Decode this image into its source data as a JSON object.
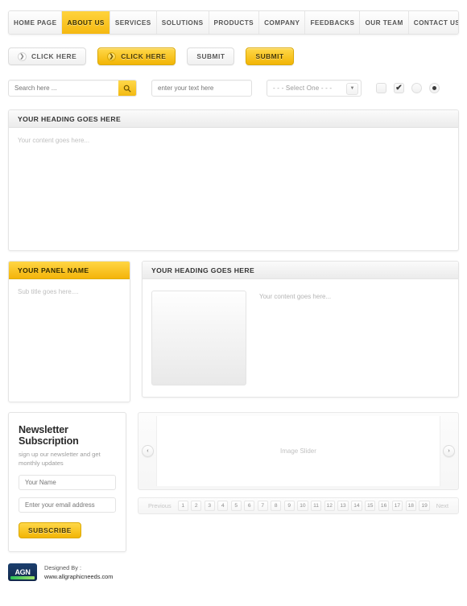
{
  "nav": {
    "items": [
      {
        "label": "HOME PAGE",
        "active": false
      },
      {
        "label": "ABOUT US",
        "active": true
      },
      {
        "label": "SERVICES",
        "active": false
      },
      {
        "label": "SOLUTIONS",
        "active": false
      },
      {
        "label": "PRODUCTS",
        "active": false
      },
      {
        "label": "COMPANY",
        "active": false
      },
      {
        "label": "FEEDBACKS",
        "active": false
      },
      {
        "label": "OUR TEAM",
        "active": false
      },
      {
        "label": "CONTACT US",
        "active": false
      }
    ]
  },
  "buttons": {
    "click_here_light": "CLICK HERE",
    "click_here_gold": "CLICK HERE",
    "submit_light": "SUBMIT",
    "submit_gold": "SUBMIT",
    "arrow_icon": "arrow-right-icon"
  },
  "form": {
    "search_placeholder": "Search here ...",
    "search_icon": "search-icon",
    "text_placeholder": "enter your text here",
    "select_value": "- - - Select One - - -",
    "select_arrow_icon": "chevron-down-icon",
    "checkbox_unchecked": "",
    "checkbox_checked": "✔",
    "radio_unchecked": "",
    "radio_checked": "●"
  },
  "heading_panel": {
    "title": "YOUR HEADING GOES HERE",
    "content": "Your content goes here..."
  },
  "side_panel": {
    "title": "YOUR PANEL NAME",
    "subtitle": "Sub title goes here...."
  },
  "media_panel": {
    "title": "YOUR HEADING GOES HERE",
    "content": "Your content goes here..."
  },
  "newsletter": {
    "title": "Newsletter Subscription",
    "subtitle": "sign up our newsletter and get monthly updates",
    "name_placeholder": "Your Name",
    "email_placeholder": "Enter your email address",
    "button": "SUBSCRIBE"
  },
  "slider": {
    "label": "Image Slider",
    "prev_icon": "chevron-left-icon",
    "next_icon": "chevron-right-icon",
    "prev_glyph": "‹",
    "next_glyph": "›"
  },
  "pagination": {
    "previous": "Previous",
    "next": "Next",
    "pages": [
      "1",
      "2",
      "3",
      "4",
      "5",
      "6",
      "7",
      "8",
      "9",
      "10",
      "11",
      "12",
      "13",
      "14",
      "15",
      "16",
      "17",
      "18",
      "19"
    ]
  },
  "footer": {
    "logo_text": "AGN",
    "designed_by": "Designed By :",
    "url": "www.allgraphicneeds.com"
  },
  "colors": {
    "accent_yellow": "#f5b911",
    "accent_yellow_light": "#ffd33d",
    "border": "#e4e4e4",
    "text_muted": "#9a9a9a",
    "logo_navy": "#1b3f6e",
    "logo_green": "#2bbf5a"
  }
}
